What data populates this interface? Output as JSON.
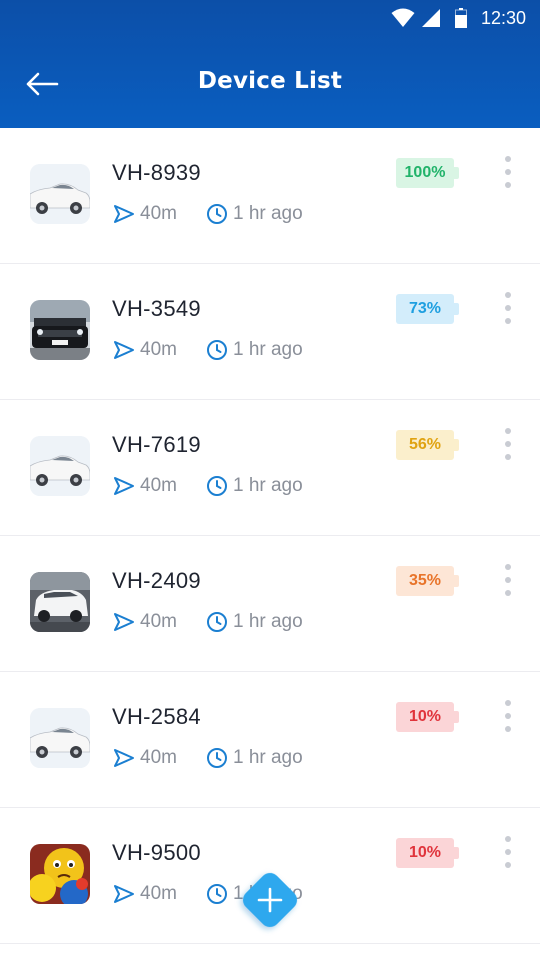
{
  "status_bar": {
    "time": "12:30",
    "icons": [
      "wifi-icon",
      "signal-icon",
      "battery-icon"
    ]
  },
  "header": {
    "title": "Device List",
    "back_icon": "arrow-left-icon",
    "color": "#0a58b8"
  },
  "devices": [
    {
      "name": "VH-8939",
      "distance": "40m",
      "time_ago": "1 hr ago",
      "battery": "100%",
      "battery_level": 1.0,
      "battery_text_color": "#21b36a",
      "battery_bg": "#d9f5e4",
      "thumb": "white-car"
    },
    {
      "name": "VH-3549",
      "distance": "40m",
      "time_ago": "1 hr ago",
      "battery": "73%",
      "battery_level": 0.73,
      "battery_text_color": "#1e9fe0",
      "battery_bg": "#d3edfb",
      "thumb": "dark-mini-car"
    },
    {
      "name": "VH-7619",
      "distance": "40m",
      "time_ago": "1 hr ago",
      "battery": "56%",
      "battery_level": 0.56,
      "battery_text_color": "#e0a312",
      "battery_bg": "#fbefcc",
      "thumb": "white-car"
    },
    {
      "name": "VH-2409",
      "distance": "40m",
      "time_ago": "1 hr ago",
      "battery": "35%",
      "battery_level": 0.35,
      "battery_text_color": "#e8742a",
      "battery_bg": "#fde6d6",
      "thumb": "white-suv"
    },
    {
      "name": "VH-2584",
      "distance": "40m",
      "time_ago": "1 hr ago",
      "battery": "10%",
      "battery_level": 0.1,
      "battery_text_color": "#e0343c",
      "battery_bg": "#fbd5d7",
      "thumb": "white-car"
    },
    {
      "name": "VH-9500",
      "distance": "40m",
      "time_ago": "1 hr ago",
      "battery": "10%",
      "battery_level": 0.1,
      "battery_text_color": "#e0343c",
      "battery_bg": "#fbd5d7",
      "thumb": "emoji-balls"
    }
  ],
  "fab": {
    "icon": "plus-icon",
    "color": "#2fa8ee"
  }
}
